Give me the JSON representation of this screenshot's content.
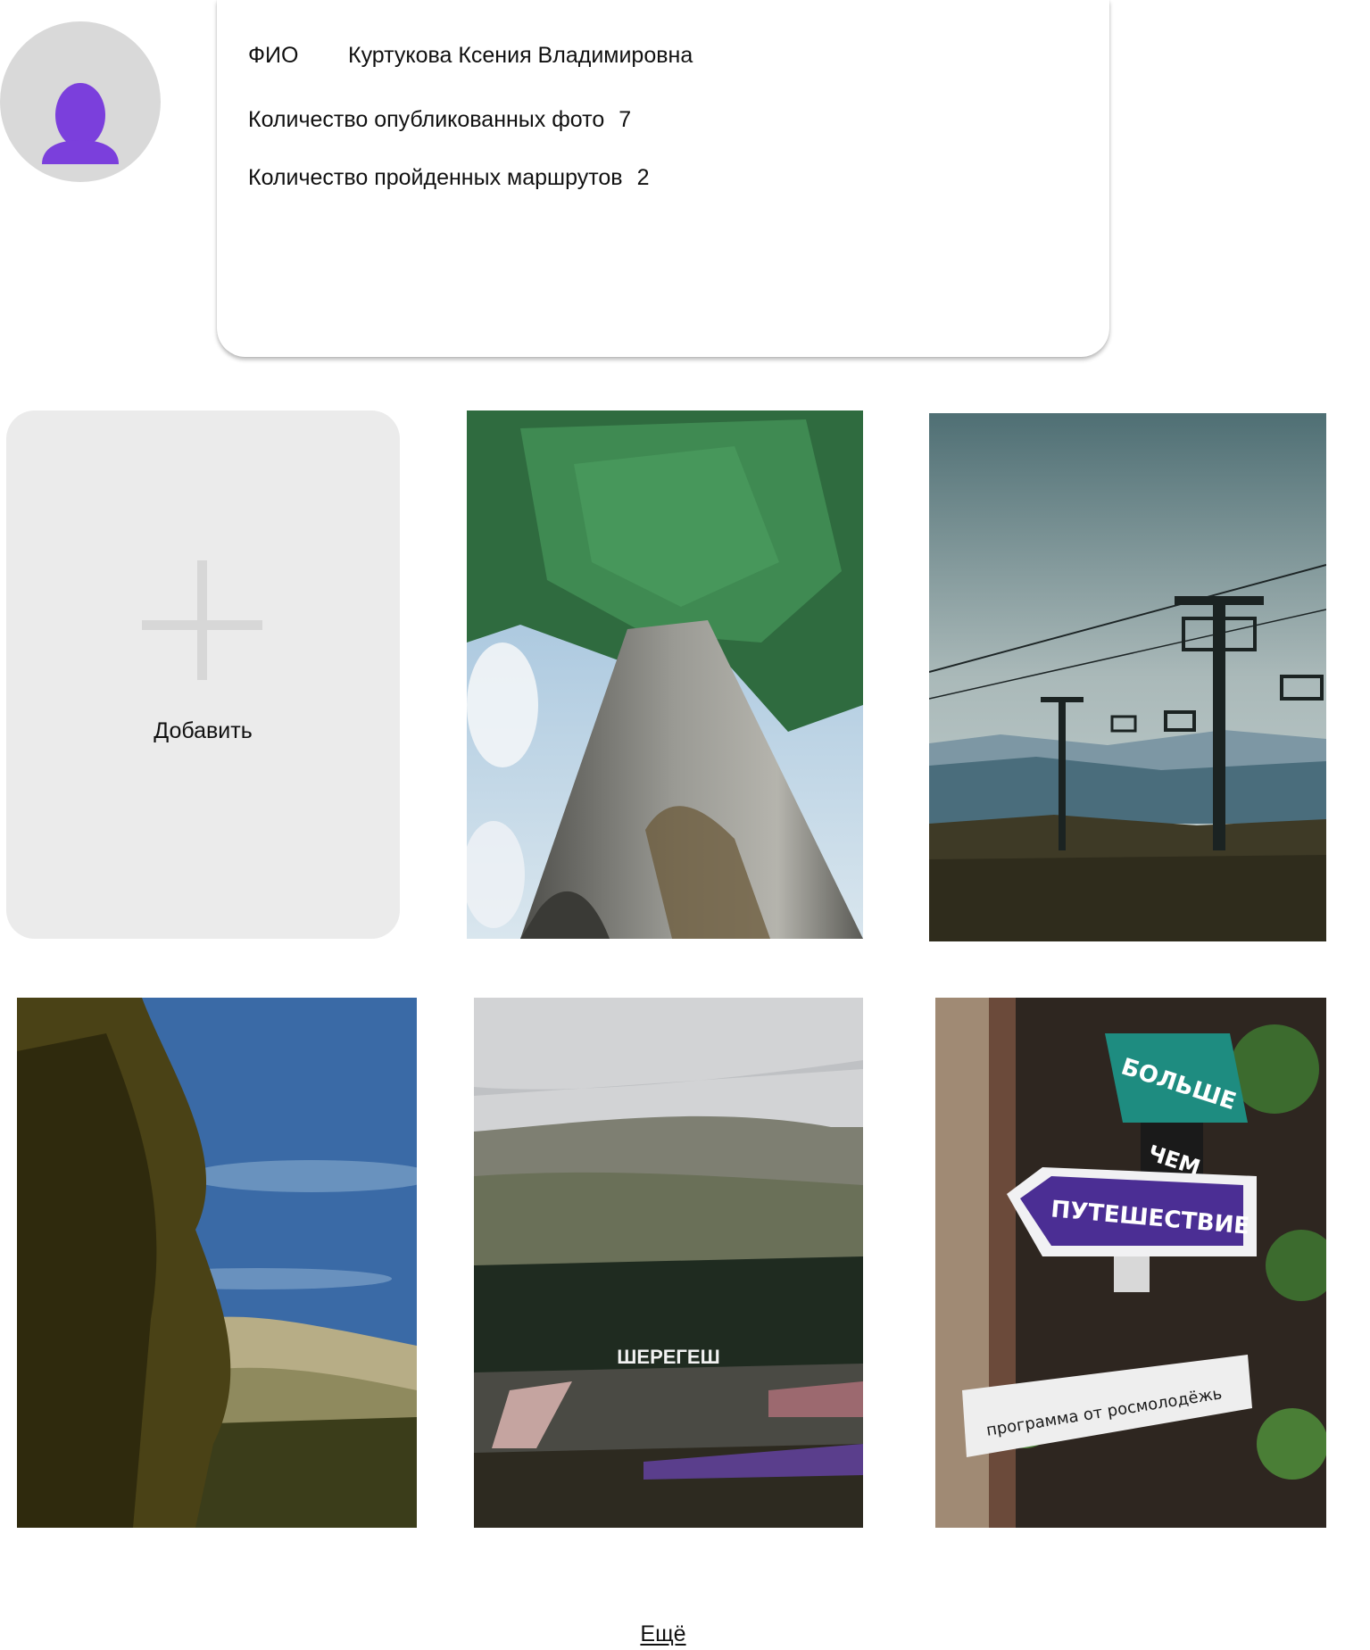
{
  "profile": {
    "avatar_icon": "user-silhouette-icon",
    "fio_label": "ФИО",
    "fio_value": "Куртукова Ксения Владимировна",
    "photos_label": "Количество опубликованных фото",
    "photos_value": "7",
    "routes_label": "Количество пройденных маршрутов",
    "routes_value": "2"
  },
  "gallery": {
    "add_icon": "plus-icon",
    "add_label": "Добавить",
    "photos": [
      {
        "subject": "tree-trunk-photo"
      },
      {
        "subject": "ski-lift-photo"
      },
      {
        "subject": "pine-hill-photo"
      },
      {
        "subject": "ski-resort-photo"
      },
      {
        "subject": "travel-sign-photo"
      }
    ],
    "sign_text_1": "БОЛЬШЕ",
    "sign_text_2": "ЧЕМ",
    "sign_text_3": "ПУТЕШЕСТВИЕ",
    "sign_text_4": "программа от росмолодёжь",
    "resort_text": "ШЕРЕГЕШ"
  },
  "more_label": "Ещё",
  "colors": {
    "accent": "#7b3fdc",
    "avatar_bg": "#d9d9d9",
    "add_card_bg": "#ebebeb",
    "plus": "#d7d7d7"
  }
}
